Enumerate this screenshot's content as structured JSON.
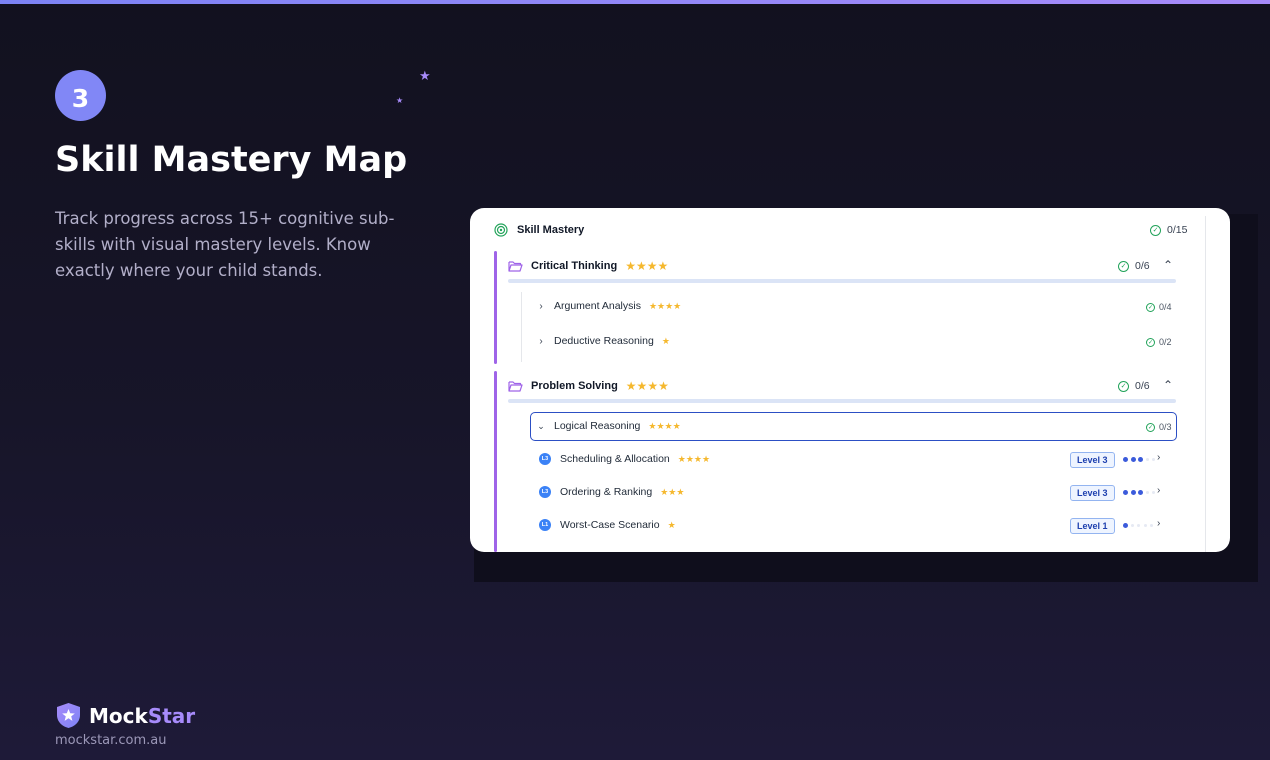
{
  "colors": {
    "accent": "#8187f6",
    "accent_light": "#a78bfa",
    "star": "#f5b82e",
    "progress_check": "#22a35a",
    "level_blue": "#3b82f6"
  },
  "step": {
    "number": "3"
  },
  "hero": {
    "title": "Skill Mastery Map",
    "description": "Track progress across 15+ cognitive sub-skills with visual mastery levels. Know exactly where your child stands."
  },
  "brand": {
    "name_main": "Mock",
    "name_accent": "Star",
    "url": "mockstar.com.au",
    "logo_icon": "shield-star-icon"
  },
  "panel": {
    "title": "Skill Mastery",
    "total": "0/15",
    "groups": [
      {
        "label": "Critical Thinking",
        "stars": "★★★★",
        "count": "0/6",
        "skills": [
          {
            "label": "Argument Analysis",
            "stars": "★★★★",
            "count": "0/4"
          },
          {
            "label": "Deductive Reasoning",
            "stars": "★",
            "count": "0/2"
          }
        ]
      },
      {
        "label": "Problem Solving",
        "stars": "★★★★",
        "count": "0/6",
        "skills": [
          {
            "label": "Logical Reasoning",
            "stars": "★★★★",
            "count": "0/3",
            "expanded": true
          }
        ],
        "subskills": [
          {
            "label": "Scheduling & Allocation",
            "stars": "★★★★",
            "badge": "L3",
            "level": "Level 3",
            "mastery": 3
          },
          {
            "label": "Ordering & Ranking",
            "stars": "★★★",
            "badge": "L3",
            "level": "Level 3",
            "mastery": 3
          },
          {
            "label": "Worst-Case Scenario",
            "stars": "★",
            "badge": "L1",
            "level": "Level 1",
            "mastery": 1
          }
        ]
      }
    ]
  }
}
